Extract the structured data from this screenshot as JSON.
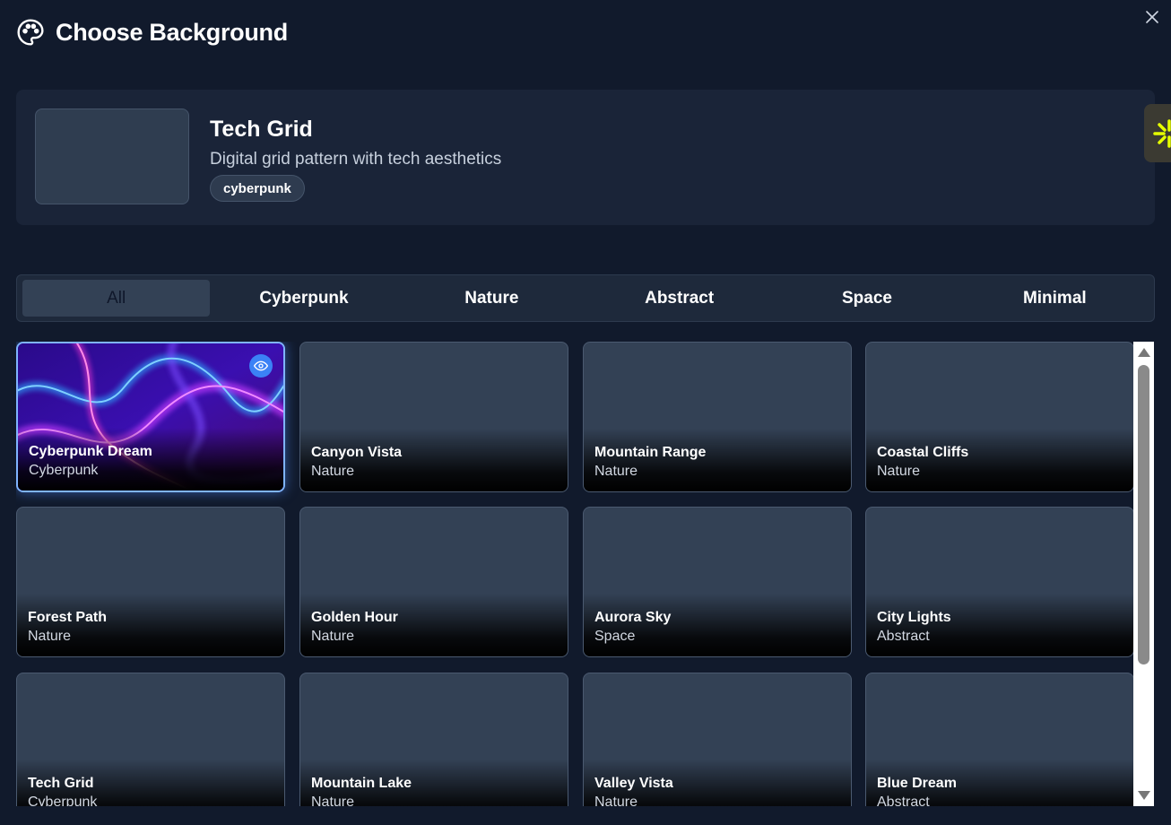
{
  "dialog": {
    "title": "Choose Background",
    "close_icon": "close-icon"
  },
  "preview": {
    "title": "Tech Grid",
    "description": "Digital grid pattern with tech aesthetics",
    "tag": "cyberpunk"
  },
  "tabs": [
    {
      "label": "All",
      "active": true
    },
    {
      "label": "Cyberpunk",
      "active": false
    },
    {
      "label": "Nature",
      "active": false
    },
    {
      "label": "Abstract",
      "active": false
    },
    {
      "label": "Space",
      "active": false
    },
    {
      "label": "Minimal",
      "active": false
    }
  ],
  "backgrounds": [
    {
      "name": "Cyberpunk Dream",
      "category": "Cyberpunk",
      "selected": true
    },
    {
      "name": "Canyon Vista",
      "category": "Nature"
    },
    {
      "name": "Mountain Range",
      "category": "Nature"
    },
    {
      "name": "Coastal Cliffs",
      "category": "Nature"
    },
    {
      "name": "Forest Path",
      "category": "Nature"
    },
    {
      "name": "Golden Hour",
      "category": "Nature"
    },
    {
      "name": "Aurora Sky",
      "category": "Space"
    },
    {
      "name": "City Lights",
      "category": "Abstract"
    },
    {
      "name": "Tech Grid",
      "category": "Cyberpunk"
    },
    {
      "name": "Mountain Lake",
      "category": "Nature"
    },
    {
      "name": "Valley Vista",
      "category": "Nature"
    },
    {
      "name": "Blue Dream",
      "category": "Abstract"
    }
  ],
  "colors": {
    "accent": "#3b82f6",
    "selected_border": "#7fb4ff",
    "card_bg": "#334155",
    "panel_bg": "#1a2438"
  }
}
